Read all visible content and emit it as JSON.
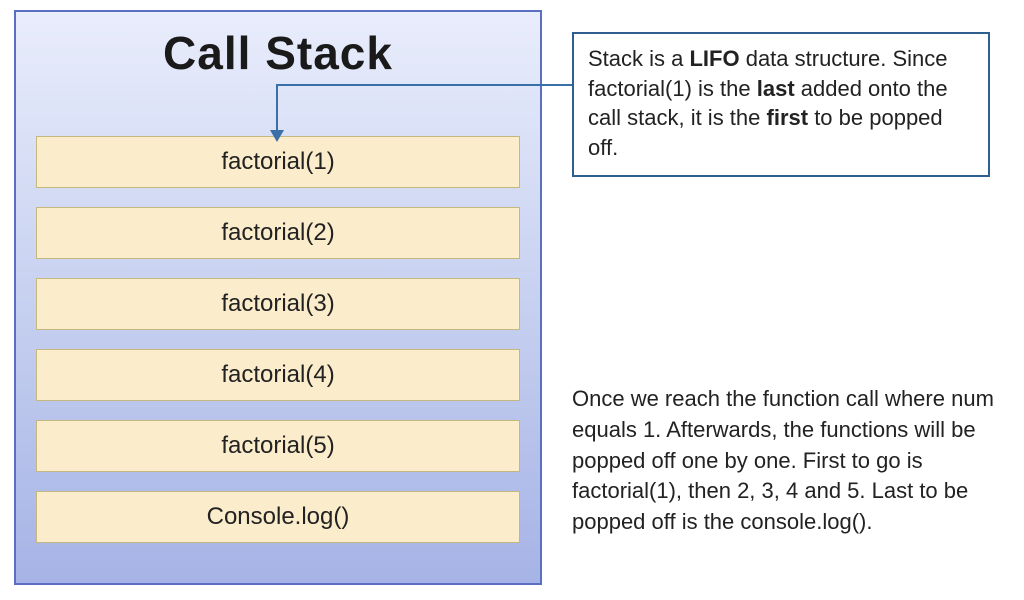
{
  "stack": {
    "title": "Call Stack",
    "frames": [
      {
        "label": "factorial(1)"
      },
      {
        "label": "factorial(2)"
      },
      {
        "label": "factorial(3)"
      },
      {
        "label": "factorial(4)"
      },
      {
        "label": "factorial(5)"
      },
      {
        "label": "Console.log()"
      }
    ]
  },
  "note": {
    "seg1": "Stack is a ",
    "bold1": "LIFO",
    "seg2": " data structure. Since factorial(1) is the ",
    "bold2": "last",
    "seg3": " added onto the call stack, it is the ",
    "bold3": "first",
    "seg4": " to be popped off."
  },
  "bottom": {
    "text": "Once we reach the function call where num equals 1. Afterwards, the functions will be popped off one by one. First to go is factorial(1), then 2, 3, 4 and 5. Last to be popped off is the console.log()."
  }
}
